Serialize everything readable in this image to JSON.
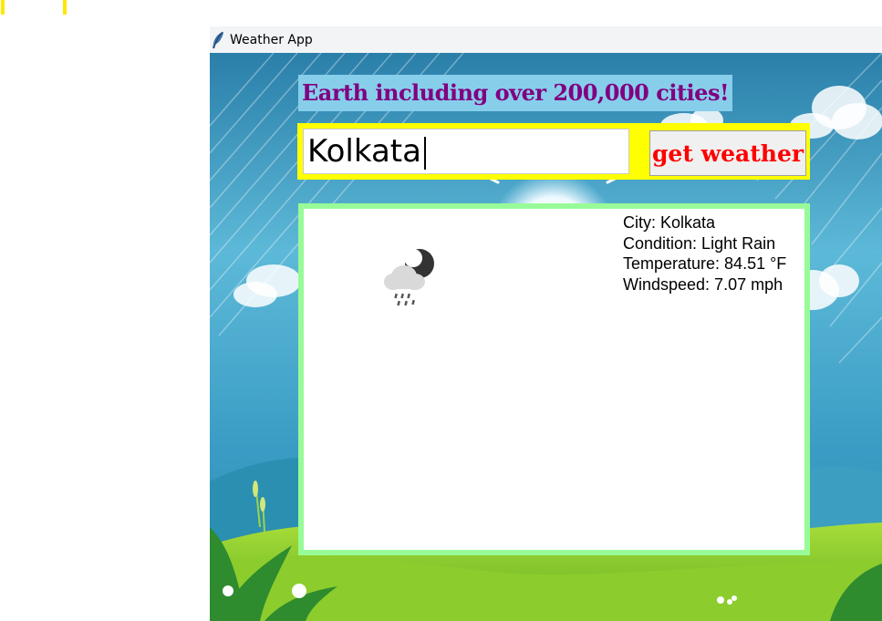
{
  "window": {
    "title": "Weather App",
    "app_icon": "feather-icon"
  },
  "heading": {
    "text": "Earth including over 200,000 cities!"
  },
  "search": {
    "city_value": "Kolkata",
    "button_label": "get weather"
  },
  "result": {
    "icon": "rain-night-cloud-icon",
    "city": "City: Kolkata",
    "condition": "Condition: Light Rain",
    "temperature": "Temperature: 84.51 °F",
    "windspeed": "Windspeed: 7.07 mph"
  },
  "colors": {
    "heading_bg": "#87ceeb",
    "heading_fg": "#800080",
    "search_frame": "#ffff00",
    "button_fg": "#ff0000",
    "panel_border": "#98fb98"
  }
}
